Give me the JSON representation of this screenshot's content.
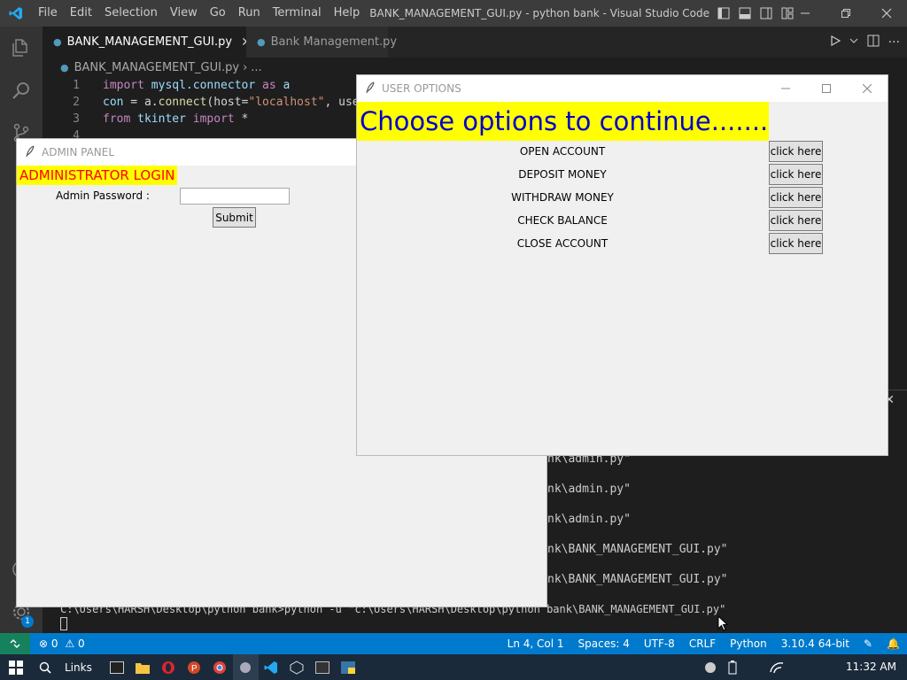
{
  "vscode": {
    "menu": [
      "File",
      "Edit",
      "Selection",
      "View",
      "Go",
      "Run",
      "Terminal",
      "Help"
    ],
    "window_title": "BANK_MANAGEMENT_GUI.py - python bank - Visual Studio Code [Adm...",
    "tabs": [
      {
        "label": "BANK_MANAGEMENT_GUI.py"
      },
      {
        "label": "Bank Management.py"
      }
    ],
    "breadcrumb": {
      "file": "BANK_MANAGEMENT_GUI.py",
      "more": "..."
    },
    "code_lines": [
      {
        "num": "1",
        "a": "import",
        "b": " mysql.connector ",
        "c": "as",
        "d": " a"
      },
      {
        "num": "2",
        "a": "con",
        "b": " = a.",
        "c": "connect",
        "d": "(host=",
        "e": "\"localhost\"",
        "f": ", user"
      },
      {
        "num": "3",
        "a": "from",
        "b": " tkinter ",
        "c": "import",
        "d": " *"
      },
      {
        "num": "4"
      }
    ],
    "terminal_lines": [
      "nk\\admin.py\"",
      "nk\\admin.py\"",
      "nk\\admin.py\"",
      "nk\\BANK_MANAGEMENT_GUI.py\"",
      "nk\\BANK_MANAGEMENT_GUI.py\"",
      "C:\\Users\\HARSH\\Desktop\\python bank>python -u \"c:\\Users\\HARSH\\Desktop\\python bank\\BANK_MANAGEMENT_GUI.py\""
    ],
    "status": {
      "errors": "0",
      "warnings": "0",
      "position": "Ln 4, Col 1",
      "spaces": "Spaces: 4",
      "encoding": "UTF-8",
      "eol": "CRLF",
      "language": "Python",
      "interpreter": "3.10.4 64-bit"
    },
    "activity_badge": "1"
  },
  "taskbar": {
    "links": "Links",
    "time": "11:32 AM"
  },
  "admin_panel": {
    "title": "ADMIN PANEL",
    "heading": "ADMINISTRATOR LOGIN",
    "password_label": "Admin Password :",
    "password_value": "",
    "submit_label": "Submit"
  },
  "user_options": {
    "title": "USER OPTIONS",
    "heading": "Choose options to continue.......",
    "options": [
      {
        "label": "OPEN ACCOUNT",
        "button": "click here"
      },
      {
        "label": "DEPOSIT MONEY",
        "button": "click here"
      },
      {
        "label": "WITHDRAW MONEY",
        "button": "click here"
      },
      {
        "label": "CHECK BALANCE",
        "button": "click here"
      },
      {
        "label": "CLOSE ACCOUNT",
        "button": "click here"
      }
    ]
  },
  "colors": {
    "vscode_accent": "#007acc",
    "heading_bg": "#ffff00",
    "admin_heading_text": "#ff0000",
    "user_heading_text": "#0000cc"
  }
}
